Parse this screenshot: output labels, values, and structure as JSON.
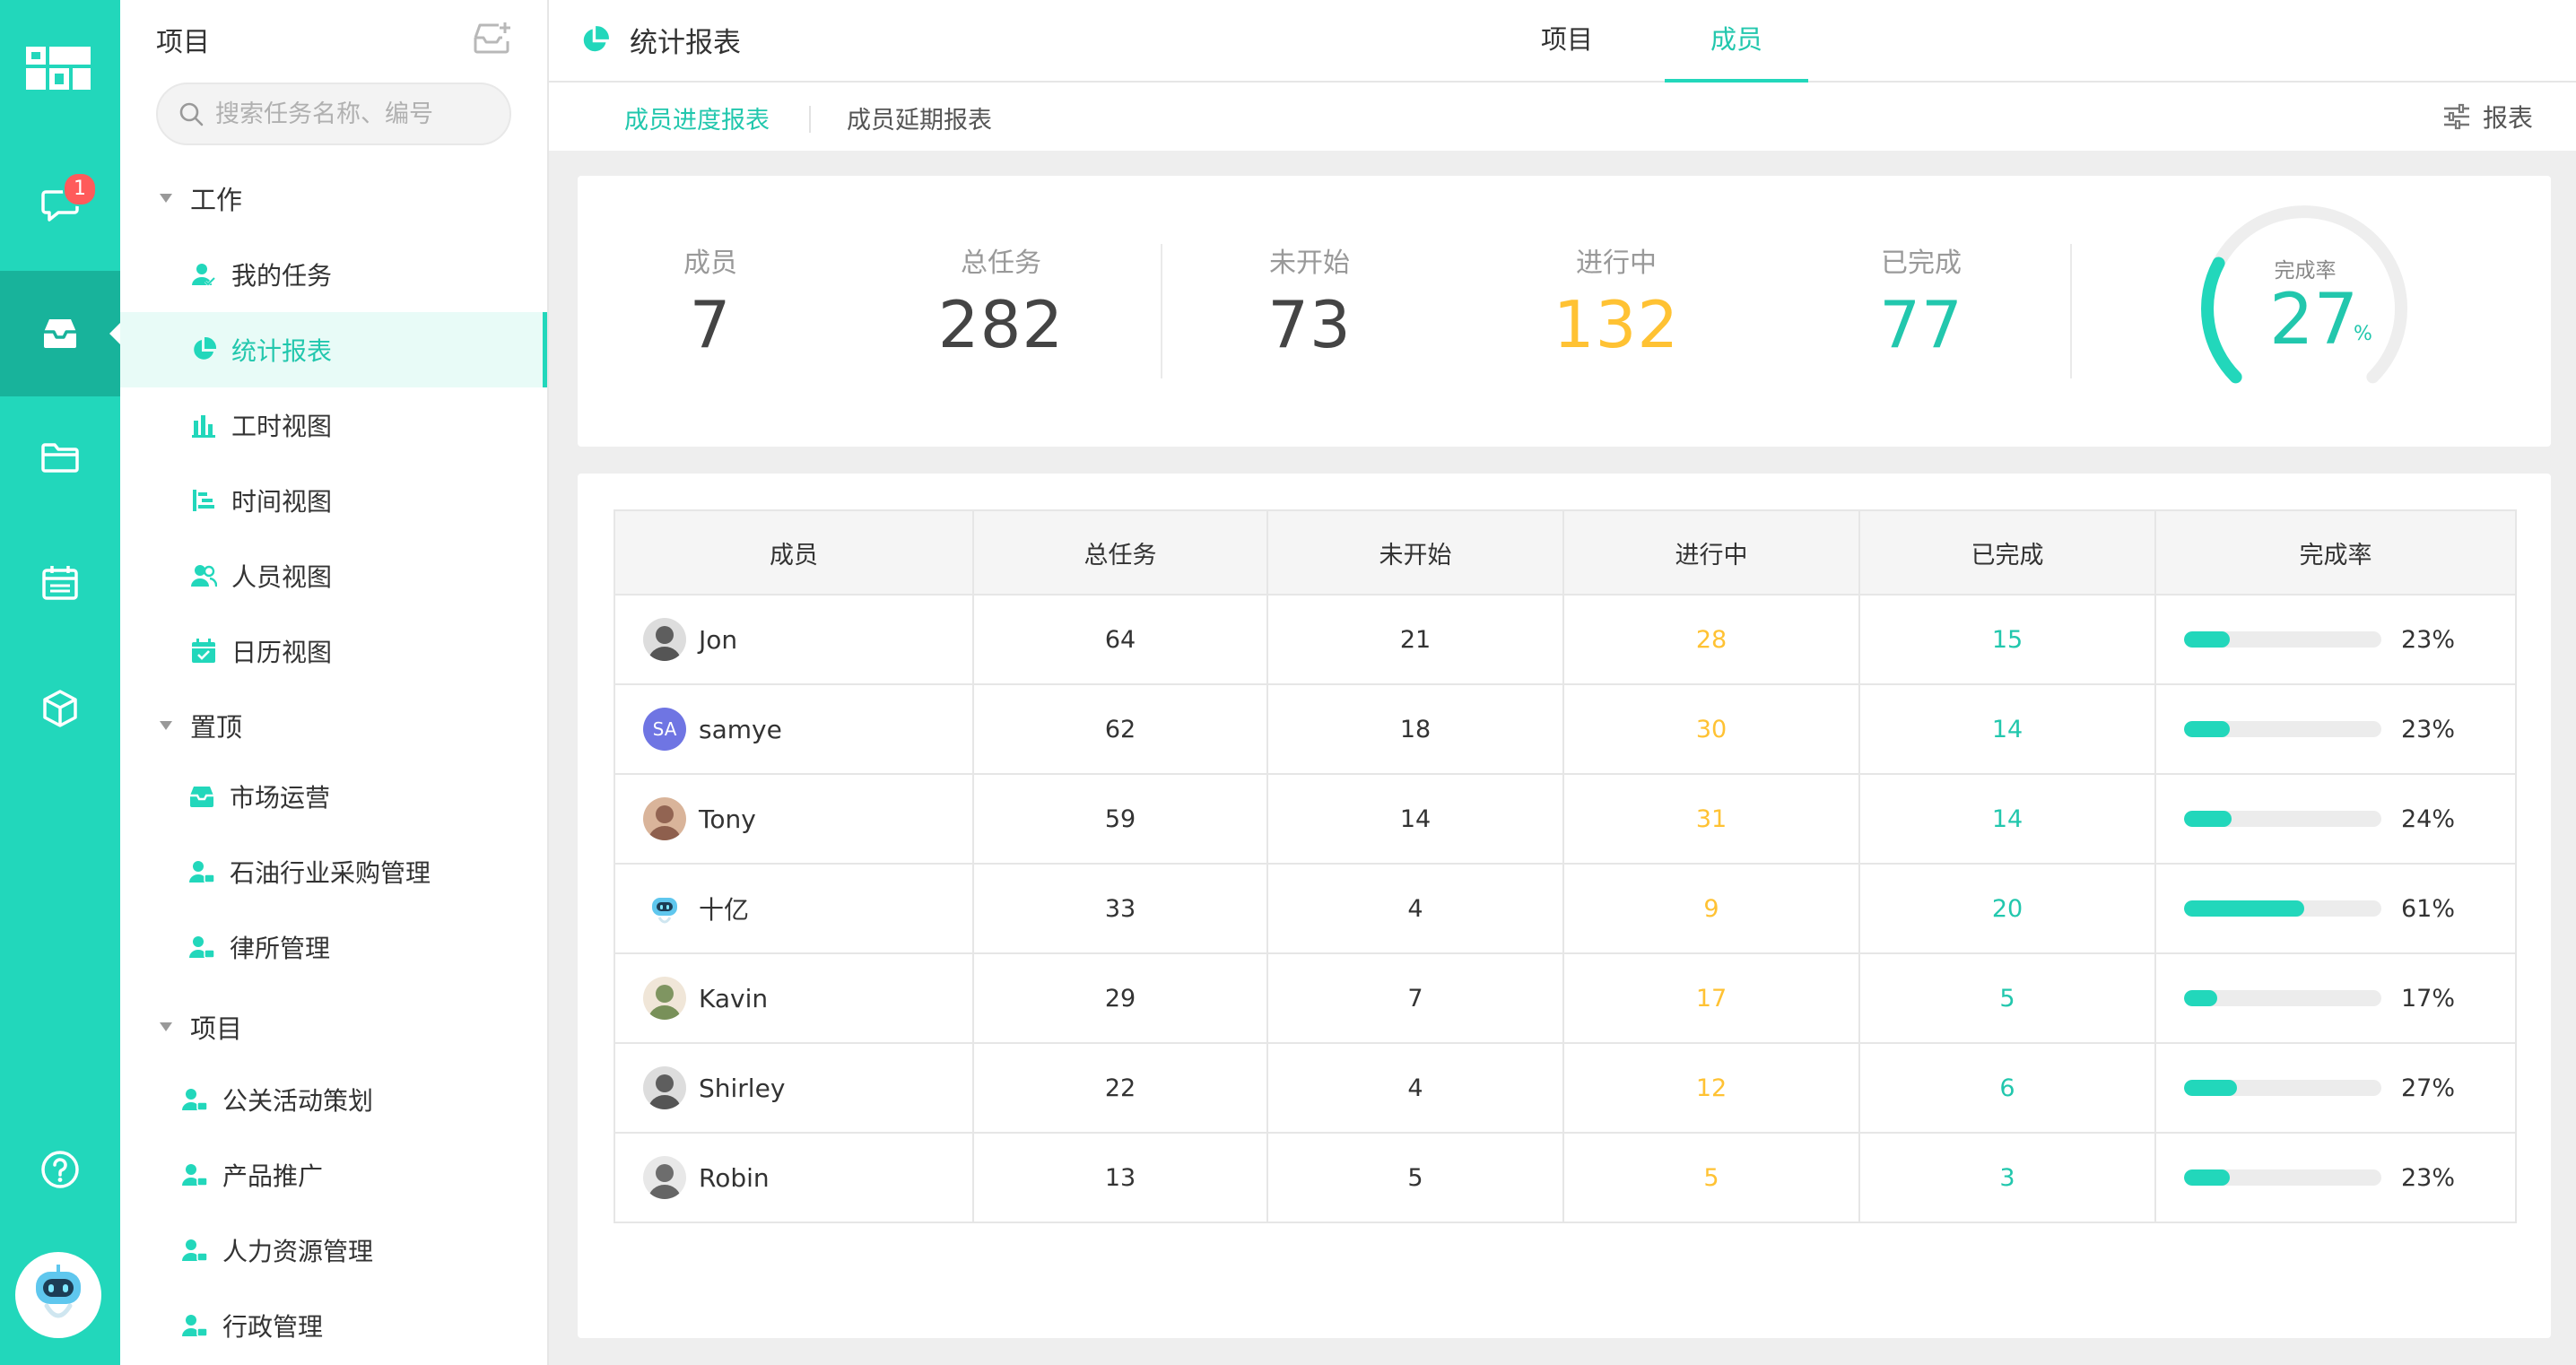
{
  "rail": {
    "badge": "1"
  },
  "sidebar": {
    "title": "项目",
    "search_placeholder": "搜索任务名称、编号",
    "groups": [
      {
        "label": "工作",
        "items": [
          "我的任务",
          "统计报表",
          "工时视图",
          "时间视图",
          "人员视图",
          "日历视图"
        ]
      },
      {
        "label": "置顶",
        "items": [
          "市场运营",
          "石油行业采购管理",
          "律所管理"
        ]
      },
      {
        "label": "项目",
        "items": [
          "公关活动策划",
          "产品推广",
          "人力资源管理",
          "行政管理"
        ]
      }
    ],
    "active_item": "统计报表"
  },
  "header": {
    "title": "统计报表",
    "tabs": [
      {
        "label": "项目",
        "active": false
      },
      {
        "label": "成员",
        "active": true
      }
    ]
  },
  "subbar": {
    "tabs": [
      {
        "label": "成员进度报表",
        "active": true
      },
      {
        "label": "成员延期报表",
        "active": false
      }
    ],
    "report_label": "报表"
  },
  "summary": {
    "members": {
      "label": "成员",
      "value": "7"
    },
    "total": {
      "label": "总任务",
      "value": "282"
    },
    "not_started": {
      "label": "未开始",
      "value": "73"
    },
    "in_progress": {
      "label": "进行中",
      "value": "132"
    },
    "done": {
      "label": "已完成",
      "value": "77"
    },
    "rate": {
      "label": "完成率",
      "value": "27",
      "unit": "%",
      "fraction": 0.27
    }
  },
  "table": {
    "headers": [
      "成员",
      "总任务",
      "未开始",
      "进行中",
      "已完成",
      "完成率"
    ],
    "rows": [
      {
        "name": "Jon",
        "avatar": "photo",
        "total": "64",
        "not_started": "21",
        "in_progress": "28",
        "done": "15",
        "rate": "23%",
        "fraction": 0.23
      },
      {
        "name": "samye",
        "avatar": "SA",
        "total": "62",
        "not_started": "18",
        "in_progress": "30",
        "done": "14",
        "rate": "23%",
        "fraction": 0.23
      },
      {
        "name": "Tony",
        "avatar": "photo",
        "total": "59",
        "not_started": "14",
        "in_progress": "31",
        "done": "14",
        "rate": "24%",
        "fraction": 0.24
      },
      {
        "name": "十亿",
        "avatar": "robot",
        "total": "33",
        "not_started": "4",
        "in_progress": "9",
        "done": "20",
        "rate": "61%",
        "fraction": 0.61
      },
      {
        "name": "Kavin",
        "avatar": "photo",
        "total": "29",
        "not_started": "7",
        "in_progress": "17",
        "done": "5",
        "rate": "17%",
        "fraction": 0.17
      },
      {
        "name": "Shirley",
        "avatar": "photo",
        "total": "22",
        "not_started": "4",
        "in_progress": "12",
        "done": "6",
        "rate": "27%",
        "fraction": 0.27
      },
      {
        "name": "Robin",
        "avatar": "photo",
        "total": "13",
        "not_started": "5",
        "in_progress": "5",
        "done": "3",
        "rate": "23%",
        "fraction": 0.23
      }
    ]
  },
  "colors": {
    "brand": "#22d7bb",
    "brand_dark": "#18b39b",
    "in_progress": "#ffc233",
    "done": "#22c7ad"
  }
}
